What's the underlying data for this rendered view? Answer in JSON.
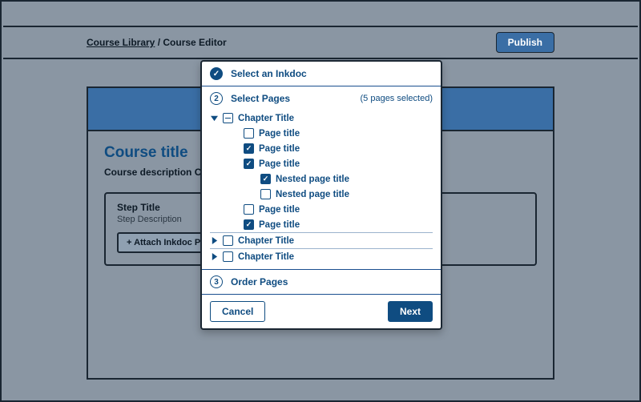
{
  "breadcrumb": {
    "link": "Course Library",
    "separator": " / ",
    "current": "Course Editor"
  },
  "publish": "Publish",
  "course": {
    "title": "Course title",
    "description": "Course description Course description Course description",
    "step_title": "Step Title",
    "step_description": "Step Description",
    "attach_label": "+ Attach Inkdoc Pages"
  },
  "dialog": {
    "step1": {
      "label": "Select an Inkdoc",
      "done_glyph": "✓"
    },
    "step2": {
      "number": "2",
      "label": "Select Pages",
      "summary": "(5 pages selected)"
    },
    "step3": {
      "number": "3",
      "label": "Order Pages"
    },
    "cancel": "Cancel",
    "next": "Next",
    "tree": {
      "chapter1": {
        "label": "Chapter Title",
        "pages": [
          {
            "label": "Page title",
            "checked": false
          },
          {
            "label": "Page title",
            "checked": true
          },
          {
            "label": "Page title",
            "checked": true,
            "children": [
              {
                "label": "Nested page title",
                "checked": true
              },
              {
                "label": "Nested page title",
                "checked": false
              }
            ]
          },
          {
            "label": "Page title",
            "checked": false
          },
          {
            "label": "Page title",
            "checked": true
          }
        ]
      },
      "chapter2": {
        "label": "Chapter Title"
      },
      "chapter3": {
        "label": "Chapter Title"
      }
    }
  }
}
